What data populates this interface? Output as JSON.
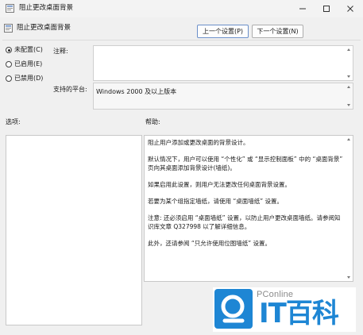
{
  "window": {
    "title": "阻止更改桌面背景",
    "buttons": {
      "minimize": "—",
      "maximize": "☐",
      "close": "✕"
    }
  },
  "header": {
    "title": "阻止更改桌面背景",
    "prev_button": "上一个设置(P)",
    "next_button": "下一个设置(N)"
  },
  "radios": [
    {
      "label": "未配置(C)",
      "checked": true
    },
    {
      "label": "已启用(E)",
      "checked": false
    },
    {
      "label": "已禁用(D)",
      "checked": false
    }
  ],
  "comment": {
    "label": "注释:",
    "value": ""
  },
  "platform": {
    "label": "支持的平台:",
    "value": "Windows 2000 及以上版本"
  },
  "options": {
    "label": "选项:"
  },
  "help": {
    "label": "帮助:",
    "paragraphs": [
      "阻止用户添加或更改桌面的背景设计。",
      "默认情况下，用户可以使用 “个性化” 或 “显示控制面板” 中的 “桌面背景” 页向其桌面添加背景设计(墙纸)。",
      "如果启用此设置，则用户无法更改任何桌面背景设置。",
      "若要为某个组指定墙纸，请使用 “桌面墙纸” 设置。",
      "注意: 还必须启用 “桌面墙纸” 设置，以防止用户更改桌面墙纸。请参阅知识库文章 Q327998 以了解详细信息。",
      "此外，还请参阅 “只允许使用位图墙纸” 设置。"
    ]
  },
  "watermark": {
    "brand": "PConline",
    "text": "IT百科"
  }
}
